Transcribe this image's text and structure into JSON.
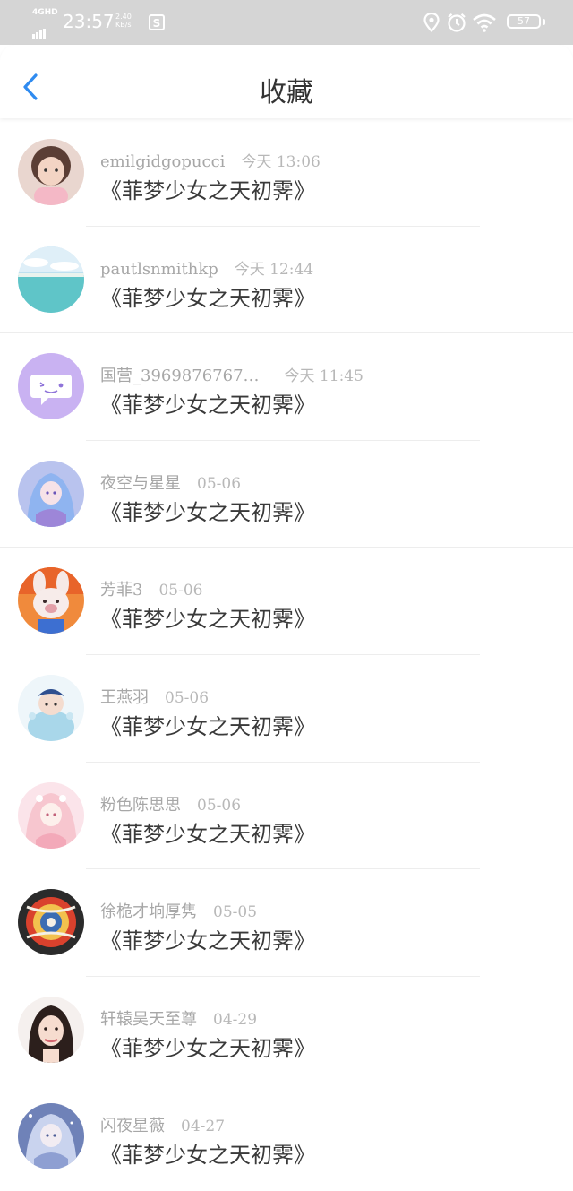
{
  "status_bar": {
    "network": "4GHD",
    "time": "23:57",
    "speed_value": "2.40",
    "speed_unit": "KB/s",
    "battery": "57"
  },
  "nav": {
    "back_icon": "chevron-left-icon",
    "title": "收藏"
  },
  "colors": {
    "accent": "#2f8bf0",
    "status_bar_bg": "#d5d5d5"
  },
  "items": [
    {
      "name": "emilgidgopucci",
      "time": "今天 13:06",
      "content": "《菲梦少女之天初霁》"
    },
    {
      "name": "pautlsnmithkp",
      "time": "今天 12:44",
      "content": "《菲梦少女之天初霁》"
    },
    {
      "name": "国营_3969876767…",
      "time": "今天 11:45",
      "content": "《菲梦少女之天初霁》"
    },
    {
      "name": "夜空与星星",
      "time": "05-06",
      "content": "《菲梦少女之天初霁》"
    },
    {
      "name": "芳菲3",
      "time": "05-06",
      "content": "《菲梦少女之天初霁》"
    },
    {
      "name": "王燕羽",
      "time": "05-06",
      "content": "《菲梦少女之天初霁》"
    },
    {
      "name": "粉色陈思思",
      "time": "05-06",
      "content": "《菲梦少女之天初霁》"
    },
    {
      "name": "徐桅才垧厚隽",
      "time": "05-05",
      "content": "《菲梦少女之天初霁》"
    },
    {
      "name": "轩辕昊天至尊",
      "time": "04-29",
      "content": "《菲梦少女之天初霁》"
    },
    {
      "name": "闪夜星薇",
      "time": "04-27",
      "content": "《菲梦少女之天初霁》"
    }
  ]
}
